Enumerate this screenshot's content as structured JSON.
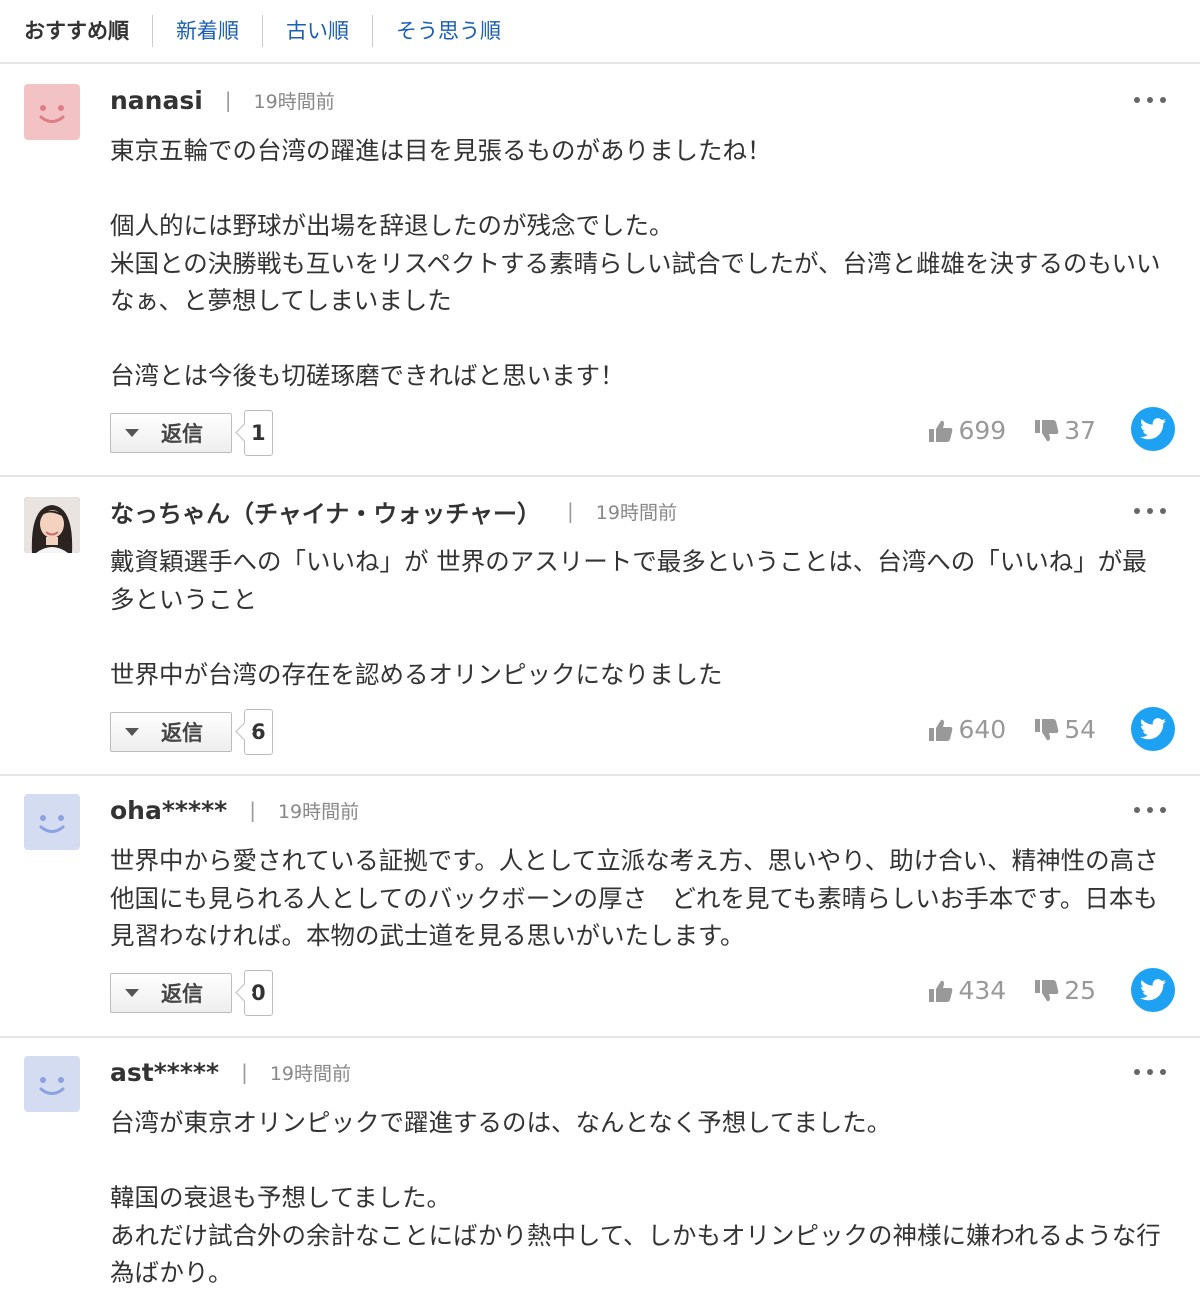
{
  "sort_tabs": [
    "おすすめ順",
    "新着順",
    "古い順",
    "そう思う順"
  ],
  "reply_label": "返信",
  "icons": {
    "sort": "none",
    "avatar_default": "smiley-face-icon",
    "more": "more-dots-icon",
    "reply": "caret-down-icon",
    "like": "thumbs-up-icon",
    "dislike": "thumbs-down-icon",
    "share": "twitter-icon"
  },
  "colors": {
    "link": "#1a5fb4",
    "avatar_pink": "#f2c2c4",
    "avatar_blue": "#d4dcf2",
    "twitter": "#1da1f2"
  },
  "comments": [
    {
      "username": "nanasi",
      "time": "19時間前",
      "avatar": "pink",
      "paragraphs": [
        "東京五輪での台湾の躍進は目を見張るものがありましたね！",
        "個人的には野球が出場を辞退したのが残念でした。\n米国との決勝戦も互いをリスペクトする素晴らしい試合でしたが、台湾と雌雄を決するのもいいなぁ、と夢想してしまいました",
        "台湾とは今後も切磋琢磨できればと思います！"
      ],
      "reply_count": "1",
      "likes": "699",
      "dislikes": "37"
    },
    {
      "username": "なっちゃん（チャイナ・ウォッチャー）",
      "time": "19時間前",
      "avatar": "photo",
      "paragraphs": [
        "戴資穎選手への「いいね」が 世界のアスリートで最多ということは、台湾への「いいね」が最多ということ",
        "世界中が台湾の存在を認めるオリンピックになりました"
      ],
      "reply_count": "6",
      "likes": "640",
      "dislikes": "54"
    },
    {
      "username": "oha*****",
      "time": "19時間前",
      "avatar": "blue",
      "paragraphs": [
        "世界中から愛されている証拠です。人として立派な考え方、思いやり、助け合い、精神性の高さ　他国にも見られる人としてのバックボーンの厚さ　どれを見ても素晴らしいお手本です。日本も見習わなければ。本物の武士道を見る思いがいたします。"
      ],
      "reply_count": "0",
      "likes": "434",
      "dislikes": "25"
    },
    {
      "username": "ast*****",
      "time": "19時間前",
      "avatar": "blue",
      "paragraphs": [
        "台湾が東京オリンピックで躍進するのは、なんとなく予想してました。",
        "韓国の衰退も予想してました。\nあれだけ試合外の余計なことにばかり熱中して、しかもオリンピックの神様に嫌われるような行為ばかり。"
      ]
    }
  ]
}
